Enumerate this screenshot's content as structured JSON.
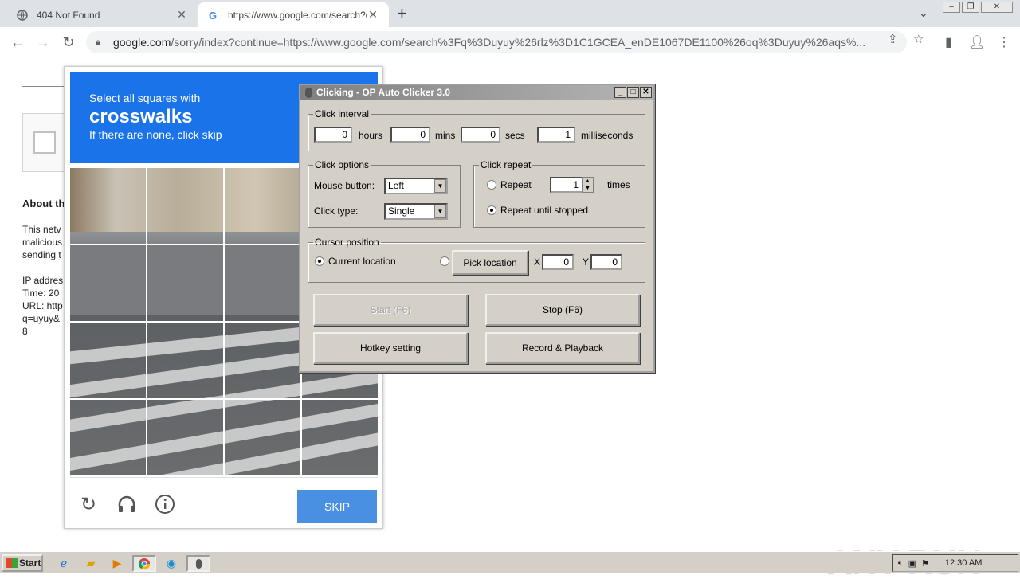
{
  "browser": {
    "tabs": [
      {
        "title": "404 Not Found"
      },
      {
        "title": "https://www.google.com/search?q="
      }
    ],
    "url_domain": "google.com",
    "url_rest": "/sorry/index?continue=https://www.google.com/search%3Fq%3Duyuy%26rlz%3D1C1GCEA_enDE1067DE1100%26oq%3Duyuy%26aqs%..."
  },
  "page": {
    "about_heading": "About th",
    "body_lines": [
      "This netv",
      "malicious",
      "sending t",
      "",
      "IP addres",
      "Time: 20",
      "URL: http",
      "q=uyuy&",
      "8"
    ]
  },
  "captcha": {
    "instruction": "Select all squares with",
    "target": "crosswalks",
    "hint": "If there are none, click skip",
    "skip_label": "SKIP"
  },
  "clicker": {
    "title": "Clicking - OP Auto Clicker 3.0",
    "interval": {
      "legend": "Click interval",
      "hours": "0",
      "hours_label": "hours",
      "mins": "0",
      "mins_label": "mins",
      "secs": "0",
      "secs_label": "secs",
      "ms": "1",
      "ms_label": "milliseconds"
    },
    "options": {
      "legend": "Click options",
      "mouse_label": "Mouse button:",
      "mouse_value": "Left",
      "type_label": "Click type:",
      "type_value": "Single"
    },
    "repeat": {
      "legend": "Click repeat",
      "repeat_label": "Repeat",
      "repeat_count": "1",
      "times_label": "times",
      "until_label": "Repeat until stopped"
    },
    "cursor": {
      "legend": "Cursor position",
      "current_label": "Current location",
      "pick_label": "Pick location",
      "x_label": "X",
      "x_value": "0",
      "y_label": "Y",
      "y_value": "0"
    },
    "buttons": {
      "start": "Start (F6)",
      "stop": "Stop (F6)",
      "hotkey": "Hotkey setting",
      "record": "Record & Playback"
    }
  },
  "watermark": "ANY RUN",
  "taskbar": {
    "start_label": "Start",
    "clock": "12:30 AM"
  }
}
